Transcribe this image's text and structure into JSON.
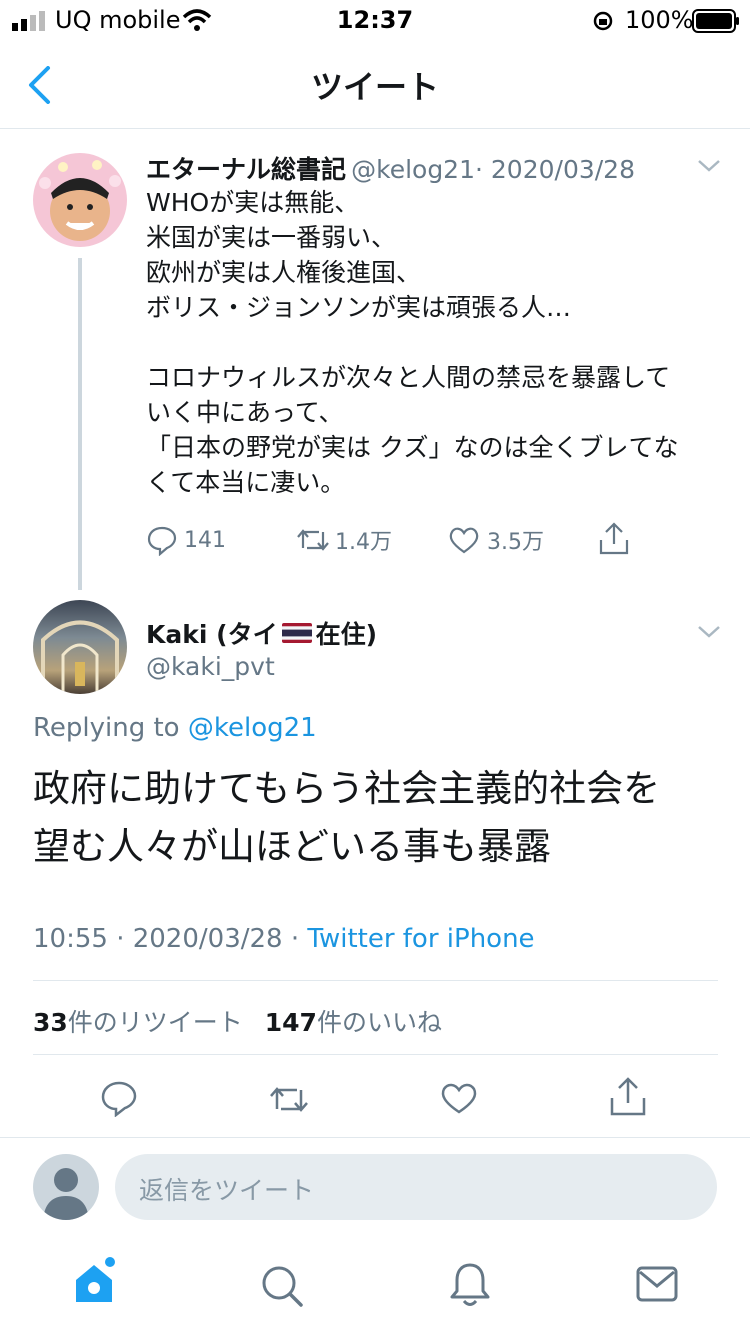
{
  "status_bar": {
    "carrier": "UQ mobile",
    "time": "12:37",
    "battery": "100%"
  },
  "nav": {
    "title": "ツイート"
  },
  "parent_tweet": {
    "display_name": "エターナル総書記",
    "handle": "@kelog21",
    "date": "· 2020/03/28",
    "lines": [
      "WHOが実は無能、",
      "米国が実は一番弱い、",
      "欧州が実は人権後進国、",
      "ボリス・ジョンソンが実は頑張る人…",
      "",
      "コロナウィルスが次々と人間の禁忌を暴露して",
      "いく中にあって、",
      "「日本の野党が実は クズ」なのは全くブレてな",
      "くて本当に凄い。"
    ],
    "reply_count": "141",
    "retweet_count": "1.4万",
    "like_count": "3.5万"
  },
  "main_tweet": {
    "display_name_pre": "Kaki (タイ",
    "display_name_post": "在住)",
    "handle": "@kaki_pvt",
    "replying_prefix": "Replying to",
    "replying_handle": "@kelog21",
    "lines": [
      "政府に助けてもらう社会主義的社会を",
      "望む人々が山ほどいる事も暴露"
    ],
    "timestamp": "10:55 · 2020/03/28 ·",
    "client": "Twitter for iPhone",
    "retweets_num": "33",
    "retweets_label": "件のリツイート",
    "likes_num": "147",
    "likes_label": "件のいいね"
  },
  "reply_composer": {
    "placeholder": "返信をツイート"
  },
  "tab_bar": {
    "items": [
      "home",
      "search",
      "notifications",
      "messages"
    ]
  },
  "colors": {
    "accent": "#1da1f2",
    "muted": "#657786",
    "divider": "#e1e8ed"
  }
}
